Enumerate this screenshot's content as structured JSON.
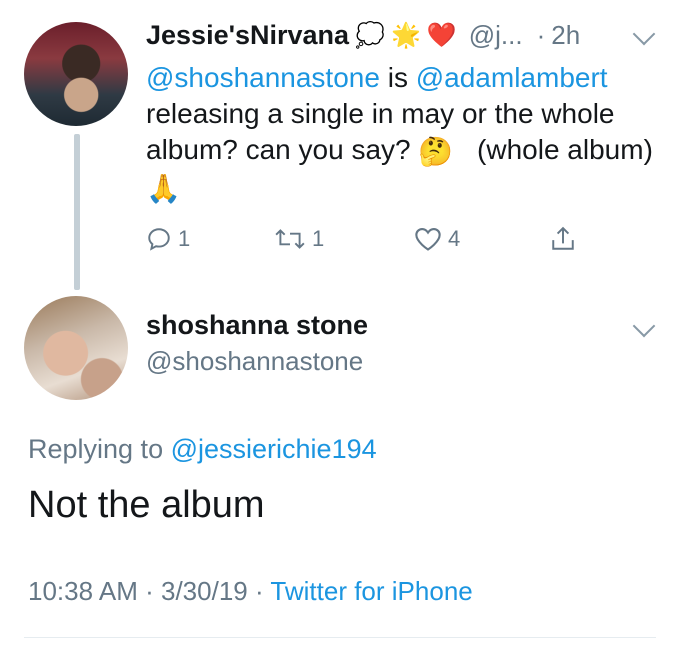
{
  "parent_tweet": {
    "display_name": "Jessie'sNirvana",
    "name_emojis": [
      "💭",
      "🌟",
      "❤️"
    ],
    "handle": "@j...",
    "time": "2h",
    "mention1": "@shoshannastone",
    "text_mid": "is",
    "mention2": "@adamlambert",
    "text_body": "releasing a single in may or the whole album?  can you say?",
    "emoji_think": "🤔",
    "text_tail": "(whole album)",
    "emoji_pray": "🙏",
    "reply_count": "1",
    "retweet_count": "1",
    "like_count": "4"
  },
  "main_tweet": {
    "display_name": "shoshanna stone",
    "handle": "@shoshannastone",
    "replying_prefix": "Replying to",
    "replying_to": "@jessierichie194",
    "text": "Not the album",
    "time": "10:38 AM",
    "date": "3/30/19",
    "source": "Twitter for iPhone",
    "separator": "·"
  },
  "colors": {
    "link": "#1b95e0",
    "muted": "#657786",
    "text": "#14171a"
  }
}
